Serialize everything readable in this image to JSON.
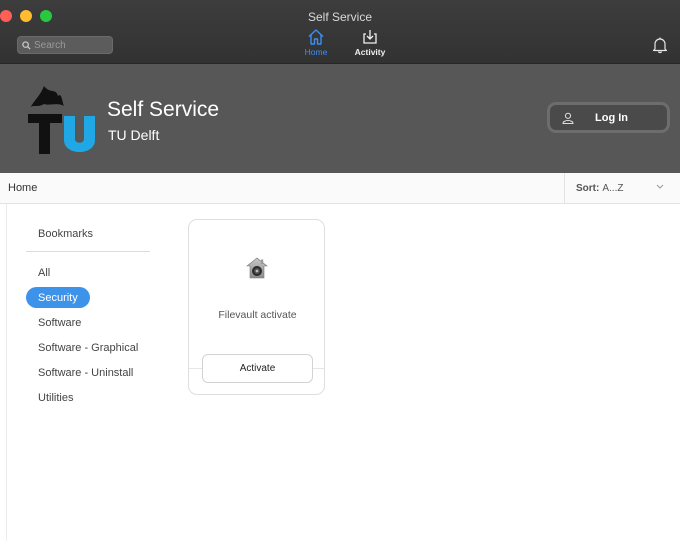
{
  "window": {
    "title": "Self Service"
  },
  "toolbar": {
    "search_placeholder": "Search",
    "home_label": "Home",
    "activity_label": "Activity"
  },
  "banner": {
    "app_title": "Self Service",
    "org_name": "TU Delft",
    "login_label": "Log In"
  },
  "breadcrumb": {
    "current": "Home"
  },
  "sort": {
    "prefix": "Sort:",
    "value": "A...Z"
  },
  "sidebar": {
    "heading": "Bookmarks",
    "items": [
      {
        "label": "All"
      },
      {
        "label": "Security"
      },
      {
        "label": "Software"
      },
      {
        "label": "Software - Graphical"
      },
      {
        "label": "Software - Uninstall"
      },
      {
        "label": "Utilities"
      }
    ],
    "selected": "Security"
  },
  "items": [
    {
      "name": "Filevault activate",
      "action_label": "Activate",
      "icon": "filevault-house-icon"
    }
  ],
  "colors": {
    "accent": "#3d93ea",
    "toolbar_bg": "#383838",
    "banner_bg": "#575757",
    "logo_blue": "#1fa7e6"
  }
}
